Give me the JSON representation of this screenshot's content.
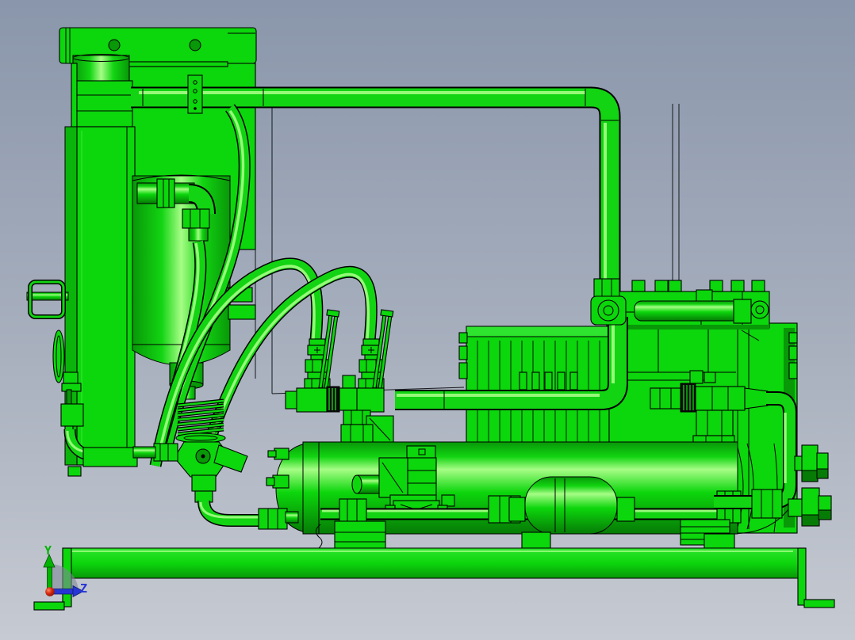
{
  "viewport": {
    "background_top_color": "#8a96ab",
    "background_bottom_color": "#c6cad2",
    "model_color": "#0cd60c",
    "model_outline_color": "#000000"
  },
  "axis_triad": {
    "y_axis": {
      "label": "Y",
      "color": "#00b400"
    },
    "z_axis": {
      "label": "Z",
      "color": "#2636d4"
    },
    "origin_color": "#d42a10"
  },
  "css_vars": {
    "bg-top": "#8a96ab",
    "bg-bottom": "#c6cad2",
    "g-main": "#0cd60c",
    "g-bright": "#2ee42e",
    "g-mid": "#12d412",
    "g-hi": "#a6fd86",
    "g-dark": "#089808",
    "g-deep": "#067c06",
    "ink": "#000000",
    "ax-y": "#00b400",
    "ax-z": "#2636d4",
    "ax-o": "#d42a10",
    "shadow": "#7e8898"
  }
}
